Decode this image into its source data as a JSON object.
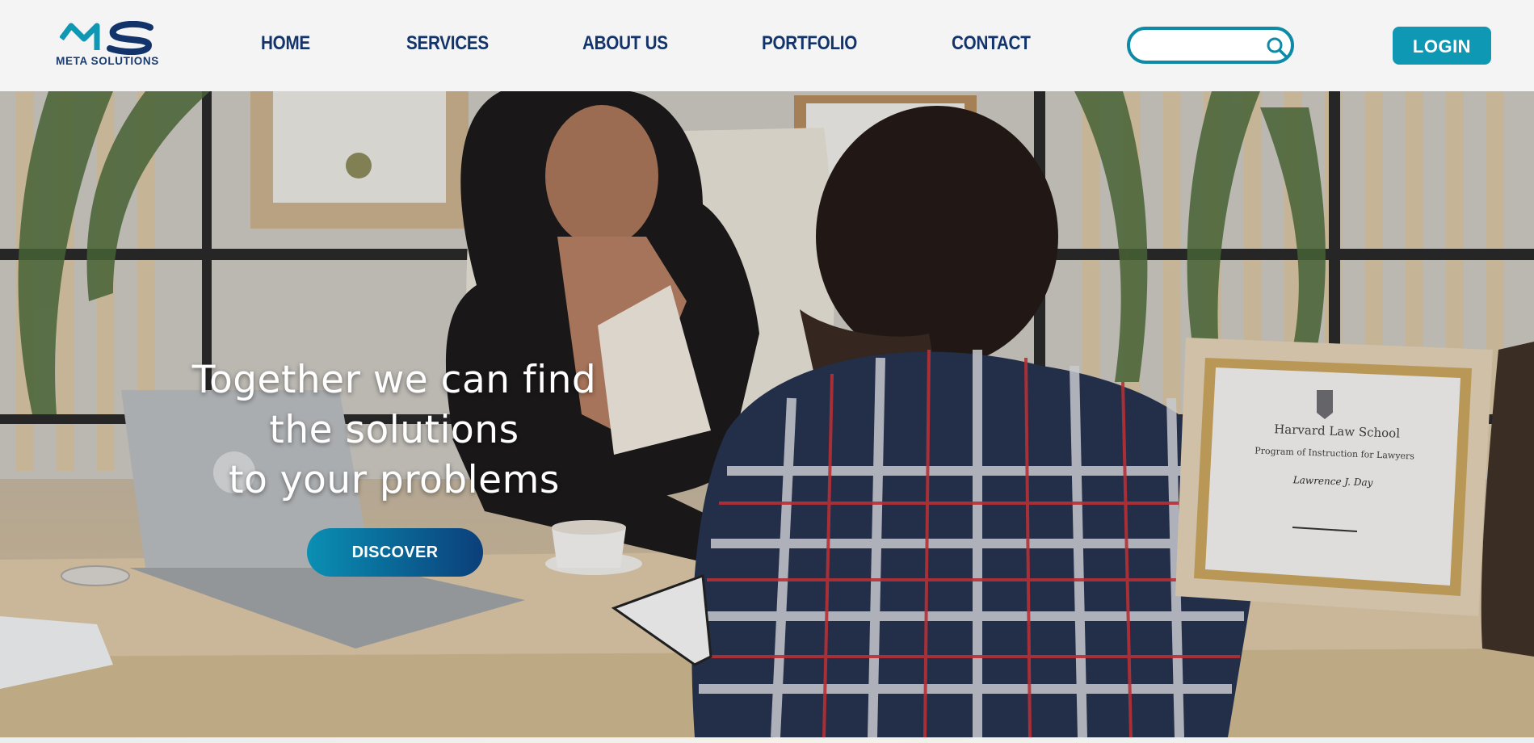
{
  "brand": {
    "name": "META SOLUTIONS",
    "colors": {
      "navy": "#13336b",
      "teal": "#0f98b4",
      "accent": "#0e8aa6"
    }
  },
  "nav": {
    "items": [
      {
        "label": "HOME"
      },
      {
        "label": "SERVICES"
      },
      {
        "label": "ABOUT US"
      },
      {
        "label": "PORTFOLIO"
      },
      {
        "label": "CONTACT"
      }
    ]
  },
  "search": {
    "value": "",
    "icon": "search-icon"
  },
  "header": {
    "login_label": "LOGIN"
  },
  "hero": {
    "headline_lines": [
      "Together we can find",
      "the solutions",
      "to your problems"
    ],
    "cta_label": "DISCOVER",
    "certificate": {
      "school": "Harvard Law School",
      "program": "Program of Instruction for Lawyers",
      "recipient": "Lawrence J. Day"
    }
  }
}
